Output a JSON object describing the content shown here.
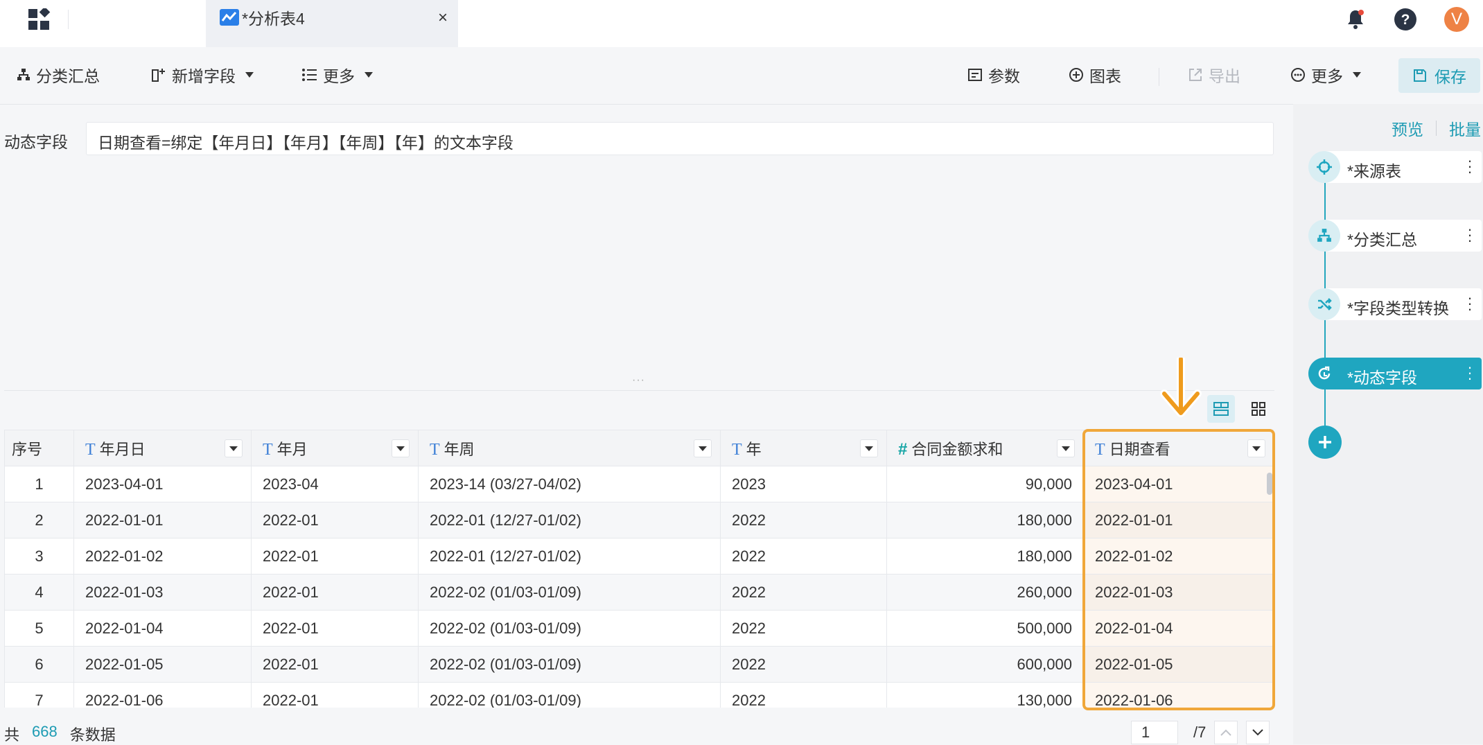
{
  "titlebar": {
    "tab_title": "*分析表4",
    "tab_close": "×",
    "avatar_letter": "V"
  },
  "toolbar": {
    "group_summary": "分类汇总",
    "add_field": "新增字段",
    "more_left": "更多",
    "params": "参数",
    "chart": "图表",
    "export": "导出",
    "more_right": "更多",
    "save": "保存"
  },
  "formula": {
    "label": "动态字段",
    "text": "日期查看=绑定【年月日】【年月】【年周】【年】的文本字段"
  },
  "table": {
    "columns": [
      {
        "label": "序号",
        "type": "index"
      },
      {
        "label": "年月日",
        "type": "text"
      },
      {
        "label": "年月",
        "type": "text"
      },
      {
        "label": "年周",
        "type": "text"
      },
      {
        "label": "年",
        "type": "text"
      },
      {
        "label": "合同金额求和",
        "type": "number"
      },
      {
        "label": "日期查看",
        "type": "text"
      }
    ],
    "rows": [
      [
        "1",
        "2023-04-01",
        "2023-04",
        "2023-14 (03/27-04/02)",
        "2023",
        "90,000",
        "2023-04-01"
      ],
      [
        "2",
        "2022-01-01",
        "2022-01",
        "2022-01 (12/27-01/02)",
        "2022",
        "180,000",
        "2022-01-01"
      ],
      [
        "3",
        "2022-01-02",
        "2022-01",
        "2022-01 (12/27-01/02)",
        "2022",
        "180,000",
        "2022-01-02"
      ],
      [
        "4",
        "2022-01-03",
        "2022-01",
        "2022-02 (01/03-01/09)",
        "2022",
        "260,000",
        "2022-01-03"
      ],
      [
        "5",
        "2022-01-04",
        "2022-01",
        "2022-02 (01/03-01/09)",
        "2022",
        "500,000",
        "2022-01-04"
      ],
      [
        "6",
        "2022-01-05",
        "2022-01",
        "2022-02 (01/03-01/09)",
        "2022",
        "600,000",
        "2022-01-05"
      ],
      [
        "7",
        "2022-01-06",
        "2022-01",
        "2022-02 (01/03-01/09)",
        "2022",
        "130,000",
        "2022-01-06"
      ]
    ]
  },
  "footer": {
    "total_prefix": "共",
    "total_count": "668",
    "total_suffix": "条数据",
    "current_page": "1",
    "total_pages": "/7"
  },
  "panel": {
    "preview": "预览",
    "batch": "批量",
    "nodes": [
      {
        "label": "*来源表",
        "icon": "target-icon"
      },
      {
        "label": "*分类汇总",
        "icon": "hierarchy-icon"
      },
      {
        "label": "*字段类型转换",
        "icon": "shuffle-icon"
      },
      {
        "label": "*动态字段",
        "icon": "refresh-icon"
      }
    ]
  },
  "colors": {
    "accent": "#1fa6c0",
    "highlight": "#f0a73a",
    "avatar": "#ee8245"
  }
}
